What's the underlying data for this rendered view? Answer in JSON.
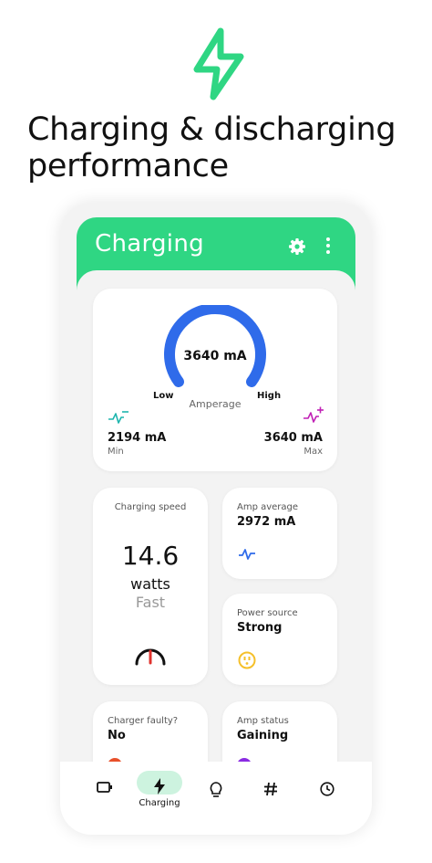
{
  "headline": "Charging & discharging performance",
  "colors": {
    "brand": "#2fd683",
    "gauge": "#2f6bea",
    "min_icon": "#1fb5ae",
    "max_icon": "#c021b5",
    "nav_pill": "#cdf3df",
    "source_icon": "#f5c02a"
  },
  "appbar": {
    "title": "Charging",
    "settings_icon": "gear-icon",
    "menu_icon": "kebab-icon"
  },
  "amperage": {
    "current": "3640 mA",
    "low_label": "Low",
    "high_label": "High",
    "label": "Amperage",
    "min_value": "2194 mA",
    "min_label": "Min",
    "max_value": "3640 mA",
    "max_label": "Max",
    "fill_fraction": 1.0
  },
  "charging_speed": {
    "title": "Charging speed",
    "value": "14.6",
    "unit": "watts",
    "state": "Fast"
  },
  "amp_average": {
    "title": "Amp average",
    "value": "2972 mA"
  },
  "power_source": {
    "title": "Power source",
    "value": "Strong"
  },
  "charger_faulty": {
    "title": "Charger faulty?",
    "value": "No"
  },
  "amp_status": {
    "title": "Amp status",
    "value": "Gaining"
  },
  "nav": {
    "active_label": "Charging",
    "items": [
      "battery-icon",
      "bolt-icon",
      "bulb-icon",
      "hash-icon",
      "clock-icon"
    ]
  }
}
